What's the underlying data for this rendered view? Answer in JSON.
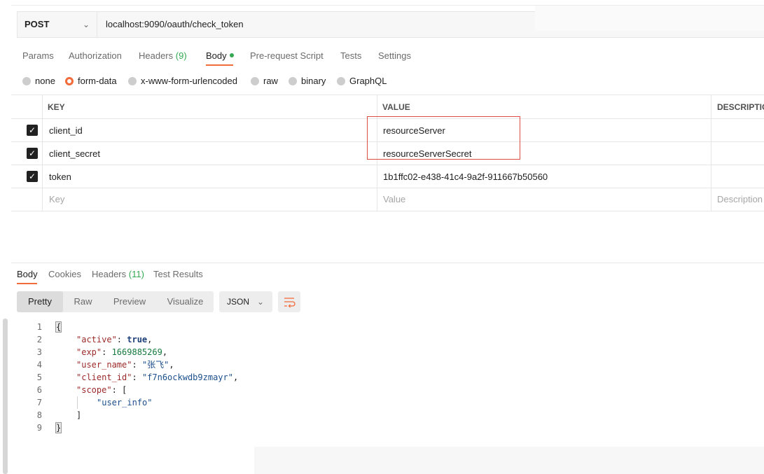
{
  "request": {
    "method": "POST",
    "url": "localhost:9090/oauth/check_token"
  },
  "request_tabs": [
    {
      "label": "Params"
    },
    {
      "label": "Authorization"
    },
    {
      "label": "Headers",
      "count": "(9)"
    },
    {
      "label": "Body"
    },
    {
      "label": "Pre-request Script"
    },
    {
      "label": "Tests"
    },
    {
      "label": "Settings"
    }
  ],
  "body_types": [
    {
      "label": "none",
      "selected": false
    },
    {
      "label": "form-data",
      "selected": true
    },
    {
      "label": "x-www-form-urlencoded",
      "selected": false
    },
    {
      "label": "raw",
      "selected": false
    },
    {
      "label": "binary",
      "selected": false
    },
    {
      "label": "GraphQL",
      "selected": false
    }
  ],
  "params_table": {
    "headers": [
      "KEY",
      "VALUE",
      "DESCRIPTIC"
    ],
    "rows": [
      {
        "checked": true,
        "key": "client_id",
        "value": "resourceServer"
      },
      {
        "checked": true,
        "key": "client_secret",
        "value": "resourceServerSecret"
      },
      {
        "checked": true,
        "key": "token",
        "value": "1b1ffc02-e438-41c4-9a2f-911667b50560"
      }
    ],
    "placeholder": {
      "key": "Key",
      "value": "Value",
      "description": "Description"
    }
  },
  "response_tabs": [
    {
      "label": "Body"
    },
    {
      "label": "Cookies"
    },
    {
      "label": "Headers",
      "count": "(11)"
    },
    {
      "label": "Test Results"
    }
  ],
  "view_modes": [
    "Pretty",
    "Raw",
    "Preview",
    "Visualize"
  ],
  "format": "JSON",
  "response_lines": [
    {
      "n": "1",
      "text": "{"
    },
    {
      "n": "2",
      "key": "\"active\"",
      "value": "true",
      "type": "bool",
      "suffix": ","
    },
    {
      "n": "3",
      "key": "\"exp\"",
      "value": "1669885269",
      "type": "num",
      "suffix": ","
    },
    {
      "n": "4",
      "key": "\"user_name\"",
      "value": "\"张飞\"",
      "type": "str",
      "suffix": ","
    },
    {
      "n": "5",
      "key": "\"client_id\"",
      "value": "\"f7n6ockwdb9zmayr\"",
      "type": "str",
      "suffix": ","
    },
    {
      "n": "6",
      "key": "\"scope\"",
      "value": "[",
      "type": "punc",
      "suffix": ""
    },
    {
      "n": "7",
      "text": "\"user_info\""
    },
    {
      "n": "8",
      "text": "]"
    },
    {
      "n": "9",
      "text": "}"
    }
  ]
}
